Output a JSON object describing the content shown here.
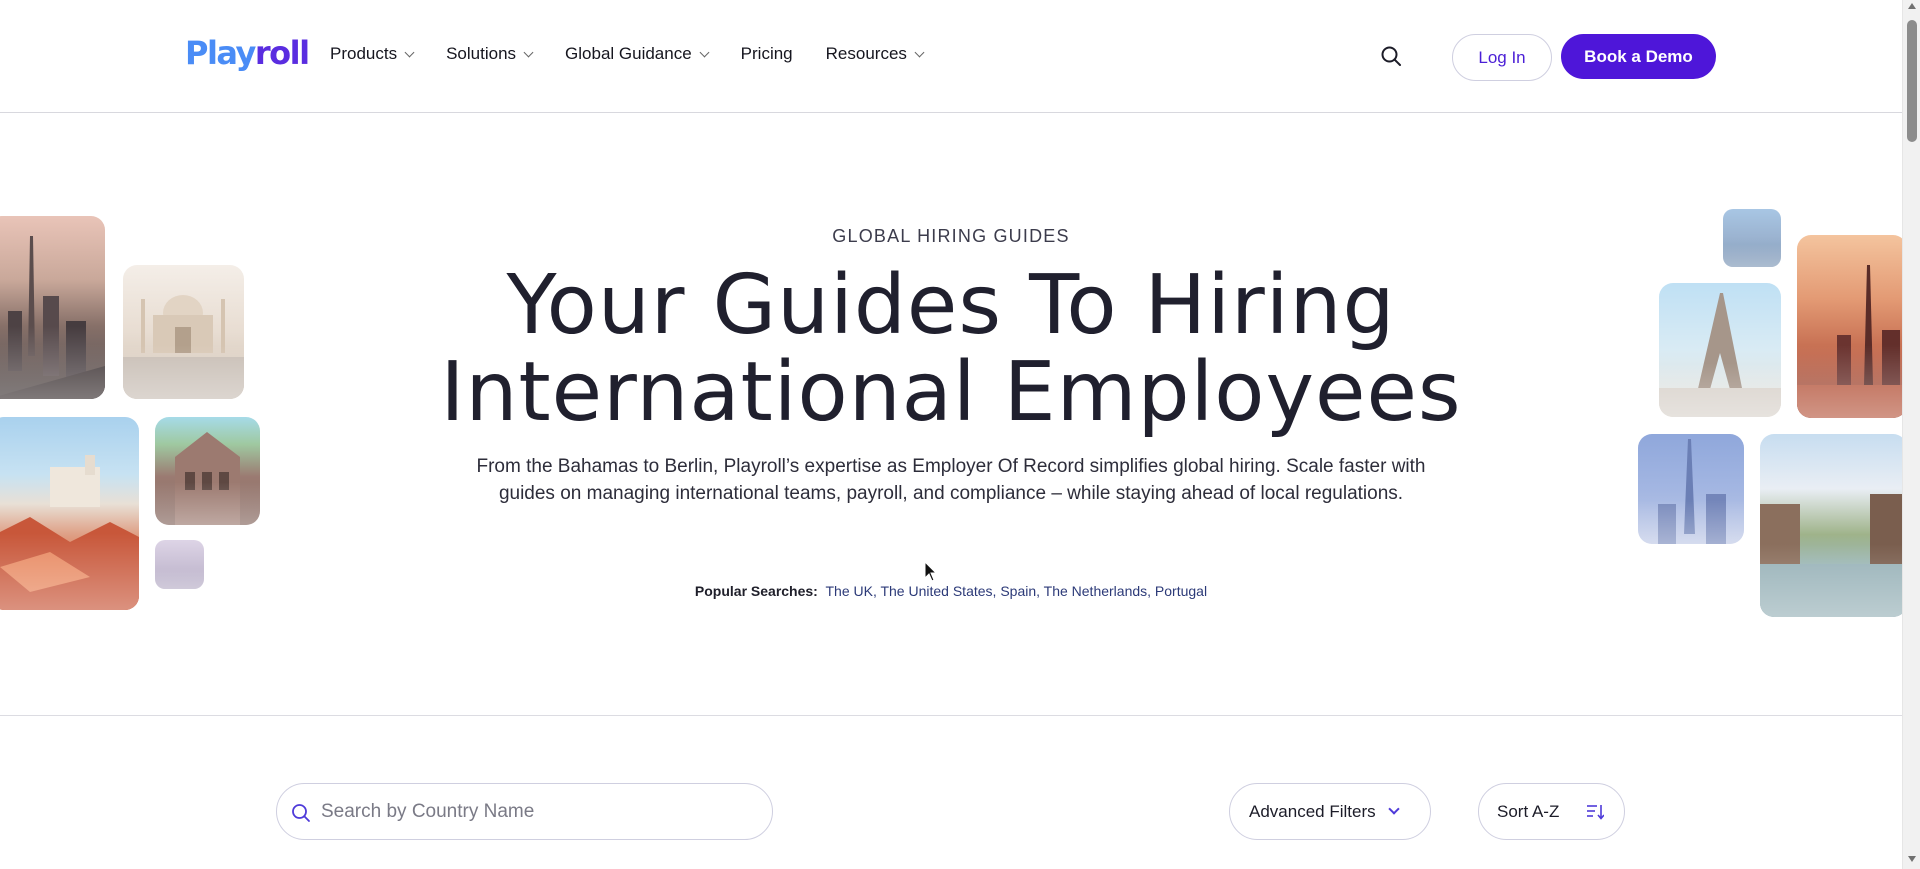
{
  "header": {
    "logo_part1": "Play",
    "logo_part2": "roll",
    "nav": [
      {
        "label": "Products",
        "has_dropdown": true
      },
      {
        "label": "Solutions",
        "has_dropdown": true
      },
      {
        "label": "Global Guidance",
        "has_dropdown": true
      },
      {
        "label": "Pricing",
        "has_dropdown": false
      },
      {
        "label": "Resources",
        "has_dropdown": true
      }
    ],
    "login_label": "Log In",
    "demo_label": "Book a Demo"
  },
  "hero": {
    "eyebrow": "GLOBAL HIRING GUIDES",
    "title_line1": "Your Guides To Hiring",
    "title_line2": "International Employees",
    "subtitle": "From the Bahamas to Berlin,  Playroll’s expertise as Employer Of Record simplifies global hiring. Scale faster with guides on managing international teams, payroll, and compliance – while staying ahead of local regulations.",
    "popular_label": "Popular Searches:",
    "popular_links": "The UK, The United States, Spain, The Netherlands, Portugal"
  },
  "filters": {
    "search_placeholder": "Search by Country Name",
    "advanced_label": "Advanced Filters",
    "sort_label": "Sort A-Z"
  },
  "colors": {
    "brand_purple": "#4e16d9",
    "logo_blue": "#4a8cf6"
  }
}
